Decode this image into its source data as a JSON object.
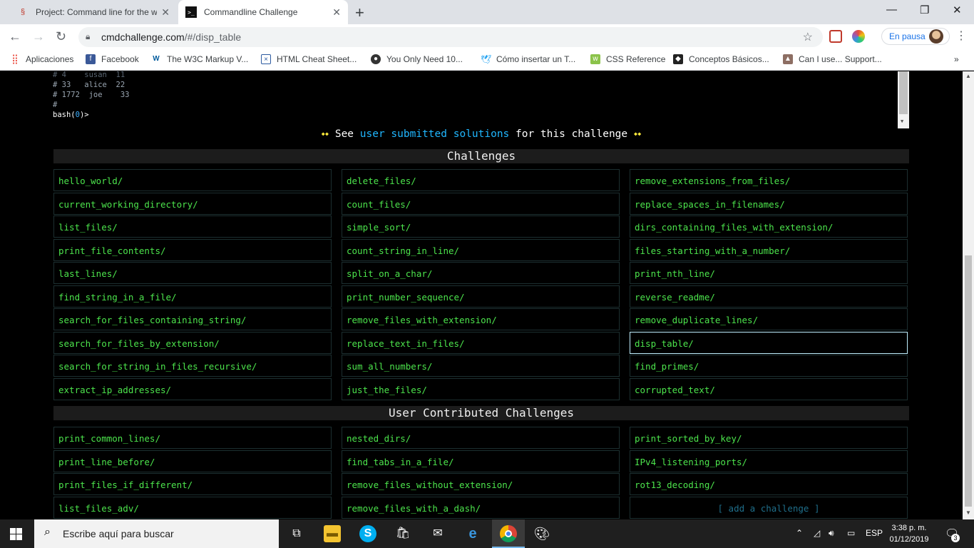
{
  "browser": {
    "tabs": [
      {
        "title": "Project: Command line for the wi",
        "close": "✕"
      },
      {
        "title": "Commandline Challenge",
        "close": "✕"
      }
    ],
    "new_tab": "+",
    "window_controls": {
      "minimize": "—",
      "maximize": "❐",
      "close": "✕"
    },
    "url_host": "cmdchallenge.com",
    "url_path": "/#/disp_table",
    "paused_label": "En pausa",
    "bookmarks": [
      {
        "label": "Aplicaciones",
        "icon": "apps-grid-icon"
      },
      {
        "label": "Facebook",
        "icon": "facebook-icon"
      },
      {
        "label": "The W3C Markup V...",
        "icon": "w3c-icon"
      },
      {
        "label": "HTML Cheat Sheet...",
        "icon": "html-icon"
      },
      {
        "label": "You Only Need 10...",
        "icon": "github-icon"
      },
      {
        "label": "Cómo insertar un T...",
        "icon": "twitter-icon"
      },
      {
        "label": "CSS Reference",
        "icon": "css-icon"
      },
      {
        "label": "Conceptos Básicos...",
        "icon": "book-icon"
      },
      {
        "label": "Can I use... Support...",
        "icon": "caniuse-icon"
      }
    ],
    "bookmarks_more": "»"
  },
  "terminal": {
    "lines": [
      "# 4    susan  11",
      "# 33   alice  22",
      "# 1772  joe    33",
      "#"
    ],
    "prompt_prefix": "bash(",
    "prompt_code": "0",
    "prompt_suffix": ")>"
  },
  "solutions_bar": {
    "left_deco": "⬩⬩",
    "text_before": "See ",
    "link": "user submitted solutions",
    "text_after": " for this challenge ",
    "right_deco": "⬩⬩"
  },
  "challenges": {
    "title": "Challenges",
    "columns": [
      [
        "hello_world/",
        "current_working_directory/",
        "list_files/",
        "print_file_contents/",
        "last_lines/",
        "find_string_in_a_file/",
        "search_for_files_containing_string/",
        "search_for_files_by_extension/",
        "search_for_string_in_files_recursive/",
        "extract_ip_addresses/"
      ],
      [
        "delete_files/",
        "count_files/",
        "simple_sort/",
        "count_string_in_line/",
        "split_on_a_char/",
        "print_number_sequence/",
        "remove_files_with_extension/",
        "replace_text_in_files/",
        "sum_all_numbers/",
        "just_the_files/"
      ],
      [
        "remove_extensions_from_files/",
        "replace_spaces_in_filenames/",
        "dirs_containing_files_with_extension/",
        "files_starting_with_a_number/",
        "print_nth_line/",
        "reverse_readme/",
        "remove_duplicate_lines/",
        "disp_table/",
        "find_primes/",
        "corrupted_text/"
      ]
    ],
    "selected": "disp_table/"
  },
  "user_challenges": {
    "title": "User Contributed Challenges",
    "columns": [
      [
        "print_common_lines/",
        "print_line_before/",
        "print_files_if_different/",
        "list_files_adv/"
      ],
      [
        "nested_dirs/",
        "find_tabs_in_a_file/",
        "remove_files_without_extension/",
        "remove_files_with_a_dash/"
      ],
      [
        "print_sorted_by_key/",
        "IPv4_listening_ports/",
        "rot13_decoding/",
        "[ add a challenge ]"
      ]
    ]
  },
  "taskbar": {
    "search_placeholder": "Escribe aquí para buscar",
    "language": "ESP",
    "time": "3:38 p. m.",
    "date": "01/12/2019",
    "notifications": "3"
  }
}
